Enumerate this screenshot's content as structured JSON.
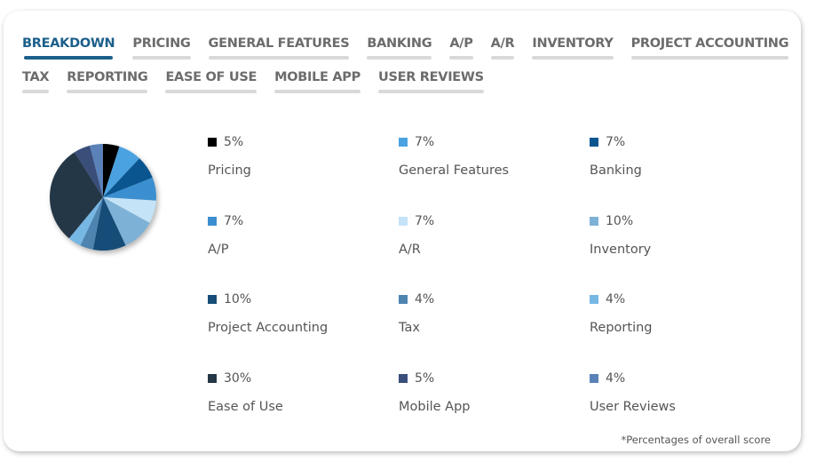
{
  "tabs": {
    "row1": [
      {
        "label": "BREAKDOWN",
        "active": true
      },
      {
        "label": "PRICING",
        "active": false
      },
      {
        "label": "GENERAL FEATURES",
        "active": false
      },
      {
        "label": "BANKING",
        "active": false
      },
      {
        "label": "A/P",
        "active": false
      },
      {
        "label": "A/R",
        "active": false
      },
      {
        "label": "INVENTORY",
        "active": false
      },
      {
        "label": "PROJECT ACCOUNTING",
        "active": false
      }
    ],
    "row2": [
      {
        "label": "TAX",
        "active": false
      },
      {
        "label": "REPORTING",
        "active": false
      },
      {
        "label": "EASE OF USE",
        "active": false
      },
      {
        "label": "MOBILE APP",
        "active": false
      },
      {
        "label": "USER REVIEWS",
        "active": false
      }
    ]
  },
  "colors": {
    "active_tab": "#1c5f8b",
    "inactive_tab": "#6c6c6c",
    "tab_underline": "#d9d9d9"
  },
  "chart_data": {
    "type": "pie",
    "title": "",
    "start_angle": "top, clockwise",
    "slices": [
      {
        "label": "Pricing",
        "value": 5,
        "display": "5%",
        "color": "#000000"
      },
      {
        "label": "General Features",
        "value": 7,
        "display": "7%",
        "color": "#4aa3e0"
      },
      {
        "label": "Banking",
        "value": 7,
        "display": "7%",
        "color": "#0a5590"
      },
      {
        "label": "A/P",
        "value": 7,
        "display": "7%",
        "color": "#3b8fd0"
      },
      {
        "label": "A/R",
        "value": 7,
        "display": "7%",
        "color": "#c4e3f7"
      },
      {
        "label": "Inventory",
        "value": 10,
        "display": "10%",
        "color": "#7eb1d6"
      },
      {
        "label": "Project Accounting",
        "value": 10,
        "display": "10%",
        "color": "#164d78"
      },
      {
        "label": "Tax",
        "value": 4,
        "display": "4%",
        "color": "#4d84b0"
      },
      {
        "label": "Reporting",
        "value": 4,
        "display": "4%",
        "color": "#77b7e4"
      },
      {
        "label": "Ease of Use",
        "value": 30,
        "display": "30%",
        "color": "#243746"
      },
      {
        "label": "Mobile App",
        "value": 5,
        "display": "5%",
        "color": "#3a4e7a"
      },
      {
        "label": "User Reviews",
        "value": 4,
        "display": "4%",
        "color": "#5a82b8"
      }
    ],
    "legend_placement": "right",
    "footnote": "*Percentages of overall score"
  }
}
